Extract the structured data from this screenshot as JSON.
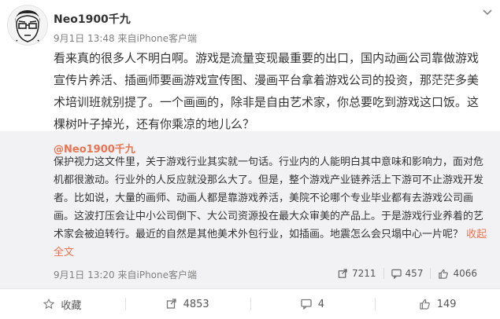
{
  "post": {
    "author": "Neo1900千九",
    "date": "9月1日 13:48",
    "source": "来自iPhone客户端",
    "text": "看来真的很多人不明白啊。游戏是流量变现最重要的出口，国内动画公司靠做游戏宣传片养活、插画师要画游戏宣传图、漫画平台拿着游戏公司的投资，那茫茫多美术培训班就别提了。一个画画的，除非是自由艺术家，你总要吃到游戏这口饭。这棵树叶子掉光，还有你乘凉的地儿么？"
  },
  "retweet": {
    "author": "@Neo1900千九",
    "text": "保护视力这文件里，关于游戏行业其实就一句话。行业内的人能明白其中意味和影响力，面对危机都很激动。行业外的人反应就没那么大了。但是，整个游戏产业链养活上下游可不止游戏开发者。比如说，大量的画师、动画人都是靠游戏养活，美院不论哪个专业毕业都有去游戏公司画画。这波打压会让中小公司倒下、大公司资源投在最大众审美的产品上。于是游戏行业养着的艺术家会被迫转行。最近的自然是其他美术外包行业，如插画。地震怎么会只塌中心一片呢？",
    "expand": "收起全文",
    "date": "9月1日 13:20",
    "source": "来自iPhone客户端",
    "shares": "7211",
    "comments": "457",
    "likes": "4066"
  },
  "actions": {
    "favorite": "收藏",
    "repost": "4853",
    "comment": "4",
    "like": "149"
  },
  "icons": [
    "avatar",
    "chevron-down-icon",
    "share-icon",
    "comment-icon",
    "like-icon",
    "star-icon"
  ]
}
